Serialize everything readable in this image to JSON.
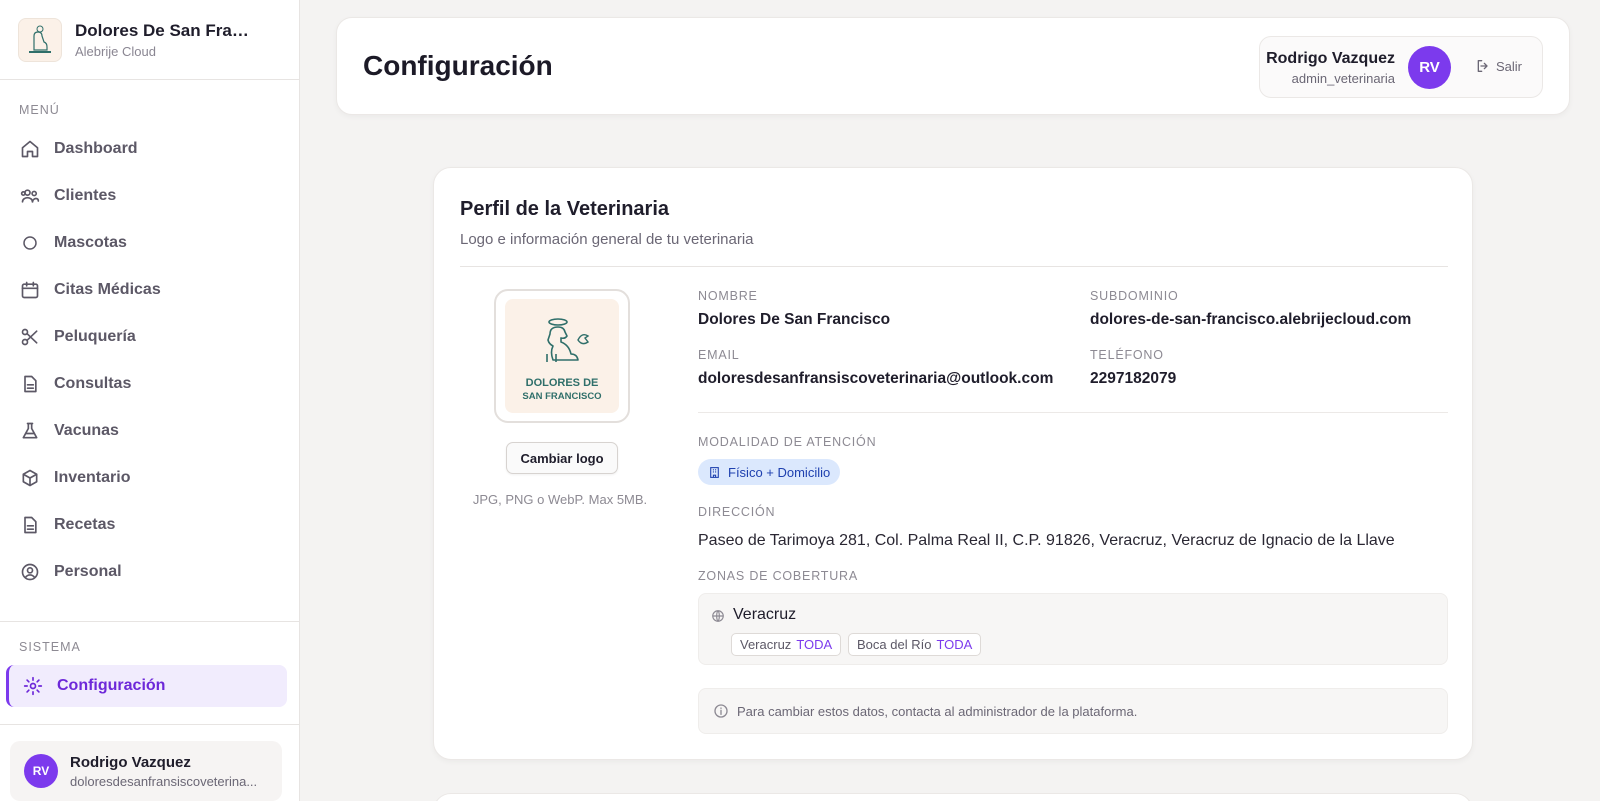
{
  "sidebar": {
    "brand_title": "Dolores De San Fran...",
    "brand_subtitle": "Alebrije Cloud",
    "menu_label": "MENÚ",
    "items": [
      {
        "label": "Dashboard",
        "icon": "home-icon"
      },
      {
        "label": "Clientes",
        "icon": "users-icon"
      },
      {
        "label": "Mascotas",
        "icon": "circle-icon"
      },
      {
        "label": "Citas Médicas",
        "icon": "calendar-icon"
      },
      {
        "label": "Peluquería",
        "icon": "scissors-icon"
      },
      {
        "label": "Consultas",
        "icon": "document-icon"
      },
      {
        "label": "Vacunas",
        "icon": "flask-icon"
      },
      {
        "label": "Inventario",
        "icon": "box-icon"
      },
      {
        "label": "Recetas",
        "icon": "document-icon"
      },
      {
        "label": "Personal",
        "icon": "user-circle-icon"
      }
    ],
    "system_label": "SISTEMA",
    "settings_label": "Configuración",
    "user": {
      "initials": "RV",
      "name": "Rodrigo Vazquez",
      "email": "doloresdesanfransiscoveterina..."
    }
  },
  "header": {
    "title": "Configuración",
    "user_name": "Rodrigo Vazquez",
    "user_role": "admin_veterinaria",
    "initials": "RV",
    "logout_label": "Salir"
  },
  "profile": {
    "title": "Perfil de la Veterinaria",
    "subtitle": "Logo e información general de tu veterinaria",
    "logo_text_line1": "DOLORES DE",
    "logo_text_line2": "SAN FRANCISCO",
    "change_logo_label": "Cambiar logo",
    "logo_hint": "JPG, PNG o WebP. Max 5MB.",
    "fields": {
      "name_label": "Nombre",
      "name_value": "Dolores De San Francisco",
      "subdomain_label": "Subdominio",
      "subdomain_value": "dolores-de-san-francisco.alebrijecloud.com",
      "email_label": "Email",
      "email_value": "doloresdesanfransiscoveterinaria@outlook.com",
      "phone_label": "Teléfono",
      "phone_value": "2297182079"
    },
    "modality_label": "Modalidad de atención",
    "modality_value": "Físico + Domicilio",
    "address_label": "Dirección",
    "address_value": "Paseo de Tarimoya 281, Col. Palma Real II, C.P. 91826, Veracruz, Veracruz de Ignacio de la Llave",
    "coverage_label": "Zonas de cobertura",
    "coverage": {
      "state": "Veracruz",
      "zones": [
        {
          "name": "Veracruz",
          "tag": "TODA"
        },
        {
          "name": "Boca del Río",
          "tag": "TODA"
        }
      ]
    },
    "note": "Para cambiar estos datos, contacta al administrador de la plataforma."
  },
  "colors": {
    "accent": "#7c3aed",
    "active_bg": "#f1ecfd",
    "badge_bg": "#dbe8fd",
    "badge_text": "#1e40af",
    "logo_teal": "#2f6f6a"
  }
}
